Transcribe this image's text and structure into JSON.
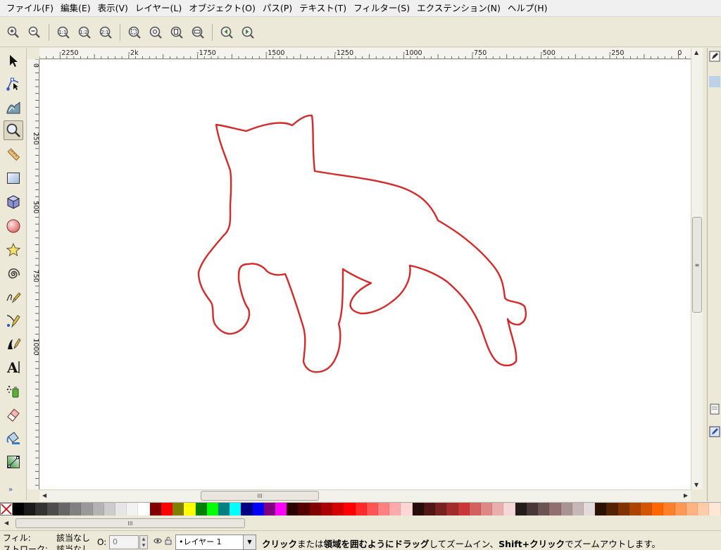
{
  "menu": {
    "items": [
      "ファイル(F)",
      "編集(E)",
      "表示(V)",
      "レイヤー(L)",
      "オブジェクト(O)",
      "パス(P)",
      "テキスト(T)",
      "フィルター(S)",
      "エクステンション(N)",
      "ヘルプ(H)"
    ]
  },
  "toolbar": {
    "zoom_buttons": [
      "zoom-in-icon",
      "zoom-out-icon",
      "zoom-1-1-icon",
      "zoom-1-2-icon",
      "zoom-2-1-icon",
      "zoom-selection-icon",
      "zoom-drawing-icon",
      "zoom-page-icon",
      "zoom-page-width-icon",
      "zoom-previous-icon",
      "zoom-next-icon"
    ]
  },
  "tools": [
    "selector-icon",
    "node-editor-icon",
    "tweak-icon",
    "zoom-icon",
    "measure-icon",
    "rectangle-icon",
    "3d-box-icon",
    "ellipse-icon",
    "star-icon",
    "spiral-icon",
    "pencil-icon",
    "pen-icon",
    "calligraphy-icon",
    "text-icon",
    "spray-icon",
    "eraser-icon",
    "paint-bucket-icon",
    "gradient-icon"
  ],
  "active_tool": "zoom-icon",
  "tools_more": "»",
  "ruler": {
    "h_labels": [
      "-2250",
      "-2k",
      "-1750",
      "-1500",
      "-1250",
      "-1000",
      "-750",
      "-500",
      "-250",
      "0"
    ],
    "v_labels": [
      "0",
      "250",
      "500",
      "750",
      "1000"
    ]
  },
  "drawing": {
    "stroke_color": "#d42a2a",
    "description_icon": "cat-outline"
  },
  "scrollbars": {
    "h_grip": "III",
    "v_grip": "≡",
    "palette_grip": "III"
  },
  "palette": {
    "colors": [
      "#000000",
      "#1a1a1a",
      "#333333",
      "#4d4d4d",
      "#666666",
      "#808080",
      "#999999",
      "#b3b3b3",
      "#cccccc",
      "#e6e6e6",
      "#f2f2f2",
      "#ffffff",
      "#800000",
      "#ff0000",
      "#808000",
      "#ffff00",
      "#008000",
      "#00ff00",
      "#008080",
      "#00ffff",
      "#000080",
      "#0000ff",
      "#800080",
      "#ff00ff",
      "#2b0000",
      "#550000",
      "#800000",
      "#aa0000",
      "#d40000",
      "#ff0000",
      "#ff2a2a",
      "#ff5555",
      "#ff8080",
      "#ffaaaa",
      "#ffd5d5",
      "#280b0b",
      "#501616",
      "#782121",
      "#a02c2c",
      "#c83737",
      "#d35f5f",
      "#de8787",
      "#e9afaf",
      "#f4d7d7",
      "#241c1c",
      "#483737",
      "#6c5353",
      "#916f6f",
      "#ac9393",
      "#c8b7b7",
      "#e3dbdb",
      "#2b1100",
      "#552200",
      "#803300",
      "#aa4400",
      "#d45500",
      "#ff6600",
      "#ff7f2a",
      "#ff9955",
      "#ffb380",
      "#ffccaa",
      "#ffe6d5"
    ]
  },
  "status": {
    "fill_label": "フィル:",
    "fill_value": "該当なし",
    "stroke_label": "ストローク:",
    "stroke_value": "該当なし",
    "opacity_label": "O:",
    "opacity_value": "0",
    "layer": "•レイヤー 1",
    "message_parts": [
      {
        "text": "クリック",
        "bold": true
      },
      {
        "text": "または",
        "bold": false
      },
      {
        "text": "領域を囲むようにドラッグ",
        "bold": true
      },
      {
        "text": "してズームイン、",
        "bold": false
      },
      {
        "text": "Shift+クリック",
        "bold": true
      },
      {
        "text": "でズームアウトします。",
        "bold": false
      }
    ]
  }
}
